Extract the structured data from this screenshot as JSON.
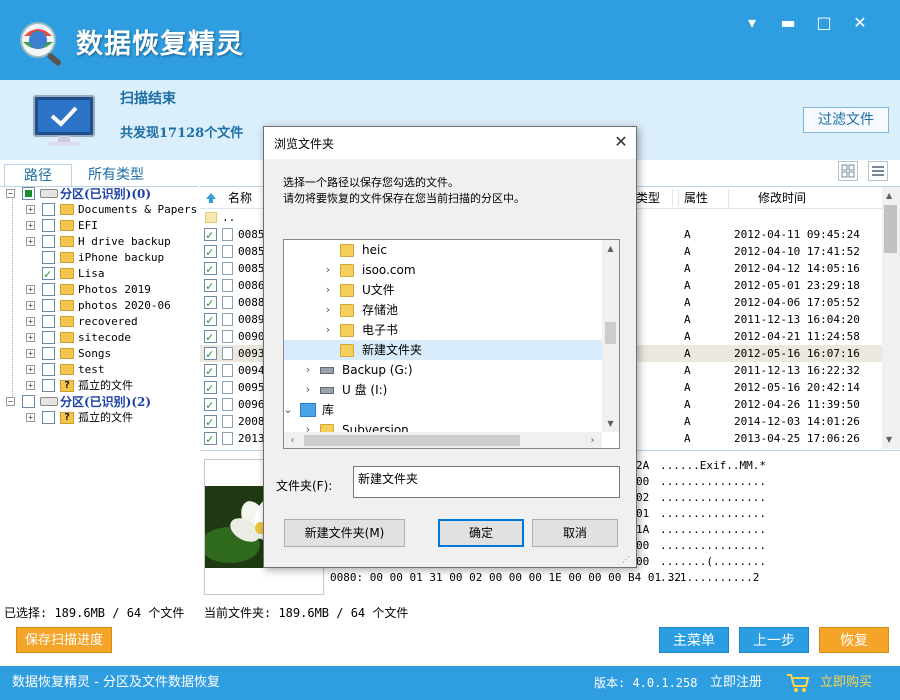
{
  "window": {
    "title_main": "数据恢复",
    "title_accent": "精灵",
    "minimize": "▾",
    "restore": "▬",
    "maximize": "□",
    "close": "✕"
  },
  "scan": {
    "title": "扫描结束",
    "count_text": "共发现17128个文件",
    "filter_button": "过滤文件"
  },
  "tabs": [
    {
      "label": "路径",
      "active": true
    },
    {
      "label": "所有类型",
      "active": false
    }
  ],
  "tree": [
    {
      "label": "分区(已识别)(0)",
      "kind": "partition",
      "level": 0,
      "expander": "−",
      "check": "partial"
    },
    {
      "label": "Documents & Papers",
      "kind": "folder",
      "level": 1,
      "expander": "+",
      "check": "none"
    },
    {
      "label": "EFI",
      "kind": "folder",
      "level": 1,
      "expander": "+",
      "check": "none"
    },
    {
      "label": "H drive backup",
      "kind": "folder",
      "level": 1,
      "expander": "+",
      "check": "none"
    },
    {
      "label": "iPhone backup",
      "kind": "folder",
      "level": 1,
      "expander": "",
      "check": "none"
    },
    {
      "label": "Lisa",
      "kind": "folder",
      "level": 1,
      "expander": "",
      "check": "checked"
    },
    {
      "label": "Photos 2019",
      "kind": "folder",
      "level": 1,
      "expander": "+",
      "check": "none"
    },
    {
      "label": "photos 2020-06",
      "kind": "folder",
      "level": 1,
      "expander": "+",
      "check": "none"
    },
    {
      "label": "recovered",
      "kind": "folder",
      "level": 1,
      "expander": "+",
      "check": "none"
    },
    {
      "label": "sitecode",
      "kind": "folder",
      "level": 1,
      "expander": "+",
      "check": "none"
    },
    {
      "label": "Songs",
      "kind": "folder",
      "level": 1,
      "expander": "+",
      "check": "none"
    },
    {
      "label": "test",
      "kind": "folder",
      "level": 1,
      "expander": "+",
      "check": "none"
    },
    {
      "label": "孤立的文件",
      "kind": "orphan",
      "level": 1,
      "expander": "+",
      "check": "none"
    },
    {
      "label": "分区(已识别)(2)",
      "kind": "partition",
      "level": 0,
      "expander": "−",
      "check": "none"
    },
    {
      "label": "孤立的文件",
      "kind": "orphan",
      "level": 1,
      "expander": "+",
      "check": "none"
    }
  ],
  "file_list": {
    "headers": {
      "name": "名称",
      "type": "类型",
      "attr": "属性",
      "mtime": "修改时间"
    },
    "parent_row": "..",
    "rows": [
      {
        "name": "0085",
        "attr": "A",
        "mtime": "2012-04-11 09:45:24",
        "checked": true,
        "highlighted": false
      },
      {
        "name": "0085",
        "attr": "A",
        "mtime": "2012-04-10 17:41:52",
        "checked": true,
        "highlighted": false
      },
      {
        "name": "0085",
        "attr": "A",
        "mtime": "2012-04-12 14:05:16",
        "checked": true,
        "highlighted": false
      },
      {
        "name": "0086",
        "attr": "A",
        "mtime": "2012-05-01 23:29:18",
        "checked": true,
        "highlighted": false
      },
      {
        "name": "0088",
        "attr": "A",
        "mtime": "2012-04-06 17:05:52",
        "checked": true,
        "highlighted": false
      },
      {
        "name": "0089",
        "attr": "A",
        "mtime": "2011-12-13 16:04:20",
        "checked": true,
        "highlighted": false
      },
      {
        "name": "0090",
        "attr": "A",
        "mtime": "2012-04-21 11:24:58",
        "checked": true,
        "highlighted": false
      },
      {
        "name": "0093",
        "attr": "A",
        "mtime": "2012-05-16 16:07:16",
        "checked": true,
        "highlighted": true
      },
      {
        "name": "0094",
        "attr": "A",
        "mtime": "2011-12-13 16:22:32",
        "checked": true,
        "highlighted": false
      },
      {
        "name": "0095",
        "attr": "A",
        "mtime": "2012-05-16 20:42:14",
        "checked": true,
        "highlighted": false
      },
      {
        "name": "0096",
        "attr": "A",
        "mtime": "2012-04-26 11:39:50",
        "checked": true,
        "highlighted": false
      },
      {
        "name": "2008",
        "attr": "A",
        "mtime": "2014-12-03 14:01:26",
        "checked": true,
        "highlighted": false
      },
      {
        "name": "2013",
        "attr": "A",
        "mtime": "2013-04-25 17:06:26",
        "checked": true,
        "highlighted": false
      }
    ]
  },
  "hex": {
    "lines": [
      {
        "hex": "2A",
        "ascii": "......Exif..MM.*"
      },
      {
        "hex": "00",
        "ascii": "................"
      },
      {
        "hex": "02",
        "ascii": "................"
      },
      {
        "hex": "01",
        "ascii": "................"
      },
      {
        "hex": "1A",
        "ascii": "................"
      },
      {
        "hex": "00",
        "ascii": "................"
      },
      {
        "hex": "00",
        "ascii": ".......(........"
      }
    ],
    "last_line": "0080: 00 00 01 31 00 02 00 00 00 1E 00 00 00 B4 01 32",
    "last_ascii": "...1..........2"
  },
  "status": {
    "selected": "已选择: 189.6MB / 64 个文件",
    "current_folder": "当前文件夹: 189.6MB / 64 个文件"
  },
  "buttons": {
    "save_progress": "保存扫描进度",
    "main_menu": "主菜单",
    "prev_step": "上一步",
    "recover": "恢复"
  },
  "footer": {
    "app_desc": "数据恢复精灵 - 分区及文件数据恢复",
    "version": "版本: 4.0.1.258",
    "register": "立即注册",
    "buy": "立即购买"
  },
  "dialog": {
    "title": "浏览文件夹",
    "close": "✕",
    "desc_line1": "选择一个路径以保存您勾选的文件。",
    "desc_line2": "请勿将要恢复的文件保存在您当前扫描的分区中。",
    "tree": [
      {
        "label": "heic",
        "kind": "folder",
        "indent": 56,
        "chevron": "",
        "selected": false
      },
      {
        "label": "isoo.com",
        "kind": "folder",
        "indent": 56,
        "chevron": "›",
        "selected": false
      },
      {
        "label": "U文件",
        "kind": "folder",
        "indent": 56,
        "chevron": "›",
        "selected": false
      },
      {
        "label": "存储池",
        "kind": "folder",
        "indent": 56,
        "chevron": "›",
        "selected": false
      },
      {
        "label": "电子书",
        "kind": "folder",
        "indent": 56,
        "chevron": "›",
        "selected": false
      },
      {
        "label": "新建文件夹",
        "kind": "folder",
        "indent": 56,
        "chevron": "",
        "selected": true
      },
      {
        "label": "Backup (G:)",
        "kind": "drive",
        "indent": 36,
        "chevron": "›",
        "selected": false
      },
      {
        "label": "U 盘 (I:)",
        "kind": "drive",
        "indent": 36,
        "chevron": "›",
        "selected": false
      },
      {
        "label": "库",
        "kind": "library",
        "indent": 16,
        "chevron": "⌄",
        "selected": false
      },
      {
        "label": "Subversion",
        "kind": "folder",
        "indent": 36,
        "chevron": "›",
        "selected": false
      }
    ],
    "folder_label": "文件夹(F):",
    "folder_value": "新建文件夹",
    "new_folder_button": "新建文件夹(M)",
    "ok_button": "确定",
    "cancel_button": "取消"
  },
  "colors": {
    "brand_blue": "#2f9ee0",
    "band_blue": "#dbeefb",
    "orange": "#f5a42a",
    "check_green": "#1c8a2e"
  }
}
